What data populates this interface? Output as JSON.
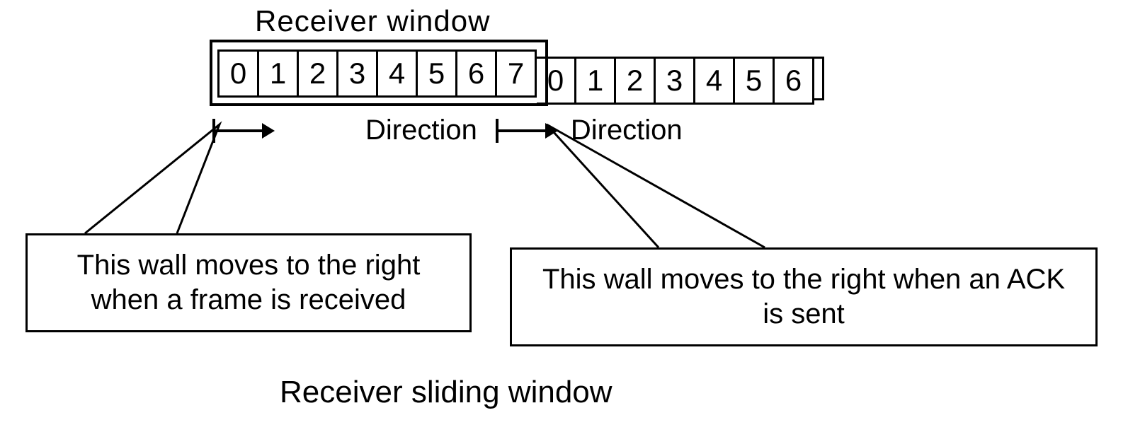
{
  "title": "Receiver window",
  "caption": "Receiver sliding window",
  "frames": {
    "group1": [
      "0",
      "1",
      "2",
      "3",
      "4",
      "5",
      "6",
      "7"
    ],
    "group2": [
      "0",
      "1",
      "2",
      "3",
      "4",
      "5",
      "6"
    ]
  },
  "direction_label_left": "Direction",
  "direction_label_right": "Direction",
  "callouts": {
    "left": "This wall moves to the right when a frame is received",
    "right": "This wall moves to the right when an ACK is sent"
  }
}
